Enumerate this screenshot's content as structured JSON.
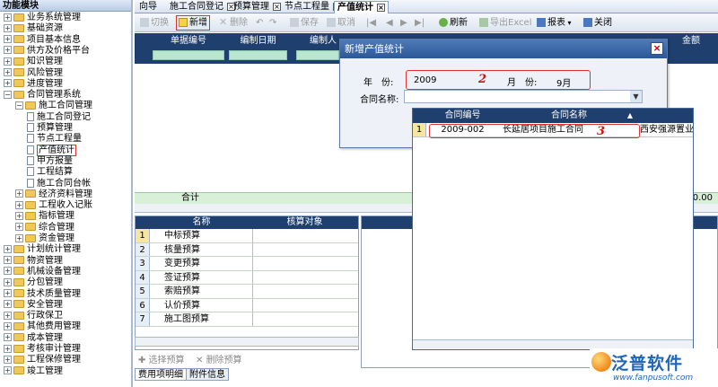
{
  "left_panel": {
    "title": "功能模块",
    "tree": [
      {
        "label": "业务系统管理",
        "level": 0,
        "expanded": false
      },
      {
        "label": "基础资源",
        "level": 0,
        "expanded": false
      },
      {
        "label": "项目基本信息",
        "level": 0,
        "expanded": false
      },
      {
        "label": "供方及价格平台",
        "level": 0,
        "expanded": false
      },
      {
        "label": "知识管理",
        "level": 0,
        "expanded": false
      },
      {
        "label": "风险管理",
        "level": 0,
        "expanded": false
      },
      {
        "label": "进度管理",
        "level": 0,
        "expanded": false
      },
      {
        "label": "合同管理系统",
        "level": 0,
        "expanded": true
      },
      {
        "label": "施工合同管理",
        "level": 1,
        "expanded": true
      },
      {
        "label": "施工合同登记",
        "level": 2,
        "leaf": true
      },
      {
        "label": "预算管理",
        "level": 2,
        "leaf": true
      },
      {
        "label": "节点工程量",
        "level": 2,
        "leaf": true
      },
      {
        "label": "产值统计",
        "level": 2,
        "leaf": true,
        "selected": true
      },
      {
        "label": "甲方报量",
        "level": 2,
        "leaf": true
      },
      {
        "label": "工程结算",
        "level": 2,
        "leaf": true
      },
      {
        "label": "施工合同台帐",
        "level": 2,
        "leaf": true
      },
      {
        "label": "经济资料管理",
        "level": 1,
        "expanded": false
      },
      {
        "label": "工程收入记账",
        "level": 1,
        "expanded": false
      },
      {
        "label": "指标管理",
        "level": 1,
        "expanded": false
      },
      {
        "label": "综合管理",
        "level": 1,
        "expanded": false
      },
      {
        "label": "资金管理",
        "level": 1,
        "expanded": false
      },
      {
        "label": "计划统计管理",
        "level": 0,
        "expanded": false
      },
      {
        "label": "物资管理",
        "level": 0,
        "expanded": false
      },
      {
        "label": "机械设备管理",
        "level": 0,
        "expanded": false
      },
      {
        "label": "分包管理",
        "level": 0,
        "expanded": false
      },
      {
        "label": "技术质量管理",
        "level": 0,
        "expanded": false
      },
      {
        "label": "安全管理",
        "level": 0,
        "expanded": false
      },
      {
        "label": "行政保卫",
        "level": 0,
        "expanded": false
      },
      {
        "label": "其他费用管理",
        "level": 0,
        "expanded": false
      },
      {
        "label": "成本管理",
        "level": 0,
        "expanded": false
      },
      {
        "label": "考核审计管理",
        "level": 0,
        "expanded": false
      },
      {
        "label": "工程保修管理",
        "level": 0,
        "expanded": false
      },
      {
        "label": "竣工管理",
        "level": 0,
        "expanded": false
      }
    ]
  },
  "tabs": [
    {
      "label": "向导",
      "active": false,
      "closable": false
    },
    {
      "label": "施工合同登记",
      "active": false,
      "closable": true
    },
    {
      "label": "预算管理",
      "active": false,
      "closable": true
    },
    {
      "label": "节点工程量",
      "active": false,
      "closable": true
    },
    {
      "label": "产值统计",
      "active": true,
      "closable": true
    }
  ],
  "toolbar": {
    "switch": "切换",
    "add": "新增",
    "delete": "删除",
    "save": "保存",
    "cancel": "取消",
    "refresh": "刷新",
    "export": "导出Excel",
    "report": "报表",
    "close": "关闭"
  },
  "grid": {
    "columns": [
      "单据编号",
      "编制日期",
      "编制人",
      "金额"
    ],
    "summary_label": "合计",
    "summary_value": "0.00"
  },
  "budget_grid": {
    "columns": [
      "名称",
      "核算对象"
    ],
    "rows": [
      {
        "no": "1",
        "name": "中标预算"
      },
      {
        "no": "2",
        "name": "核量预算"
      },
      {
        "no": "3",
        "name": "变更预算"
      },
      {
        "no": "4",
        "name": "签证预算"
      },
      {
        "no": "5",
        "name": "索赔预算"
      },
      {
        "no": "6",
        "name": "认价预算"
      },
      {
        "no": "7",
        "name": "施工图预算"
      }
    ],
    "select_budget": "选择预算",
    "delete_budget": "删除预算"
  },
  "bottom_tabs": [
    "费用项明细",
    "附件信息"
  ],
  "modal": {
    "title": "新增产值统计",
    "close_symbol": "×",
    "year_label": "年　份:",
    "year_value": "2009",
    "month_label": "月　份:",
    "month_value": "9月",
    "contract_label": "合同名称:",
    "annotation_2": "2"
  },
  "popup": {
    "columns": [
      "合同编号",
      "合同名称"
    ],
    "rows": [
      {
        "no": "1",
        "code": "2009-002",
        "name": "长延居项目施工合同",
        "customer": "西安强源置业"
      }
    ],
    "annotation_3": "3"
  },
  "logo": {
    "name": "泛普软件",
    "url": "www.fanpusoft.com"
  },
  "colors": {
    "header_navy": "#1f3f6e",
    "highlight_red": "#e03030",
    "filter_green": "#b8e6d0",
    "logo_blue": "#1f66b8"
  }
}
